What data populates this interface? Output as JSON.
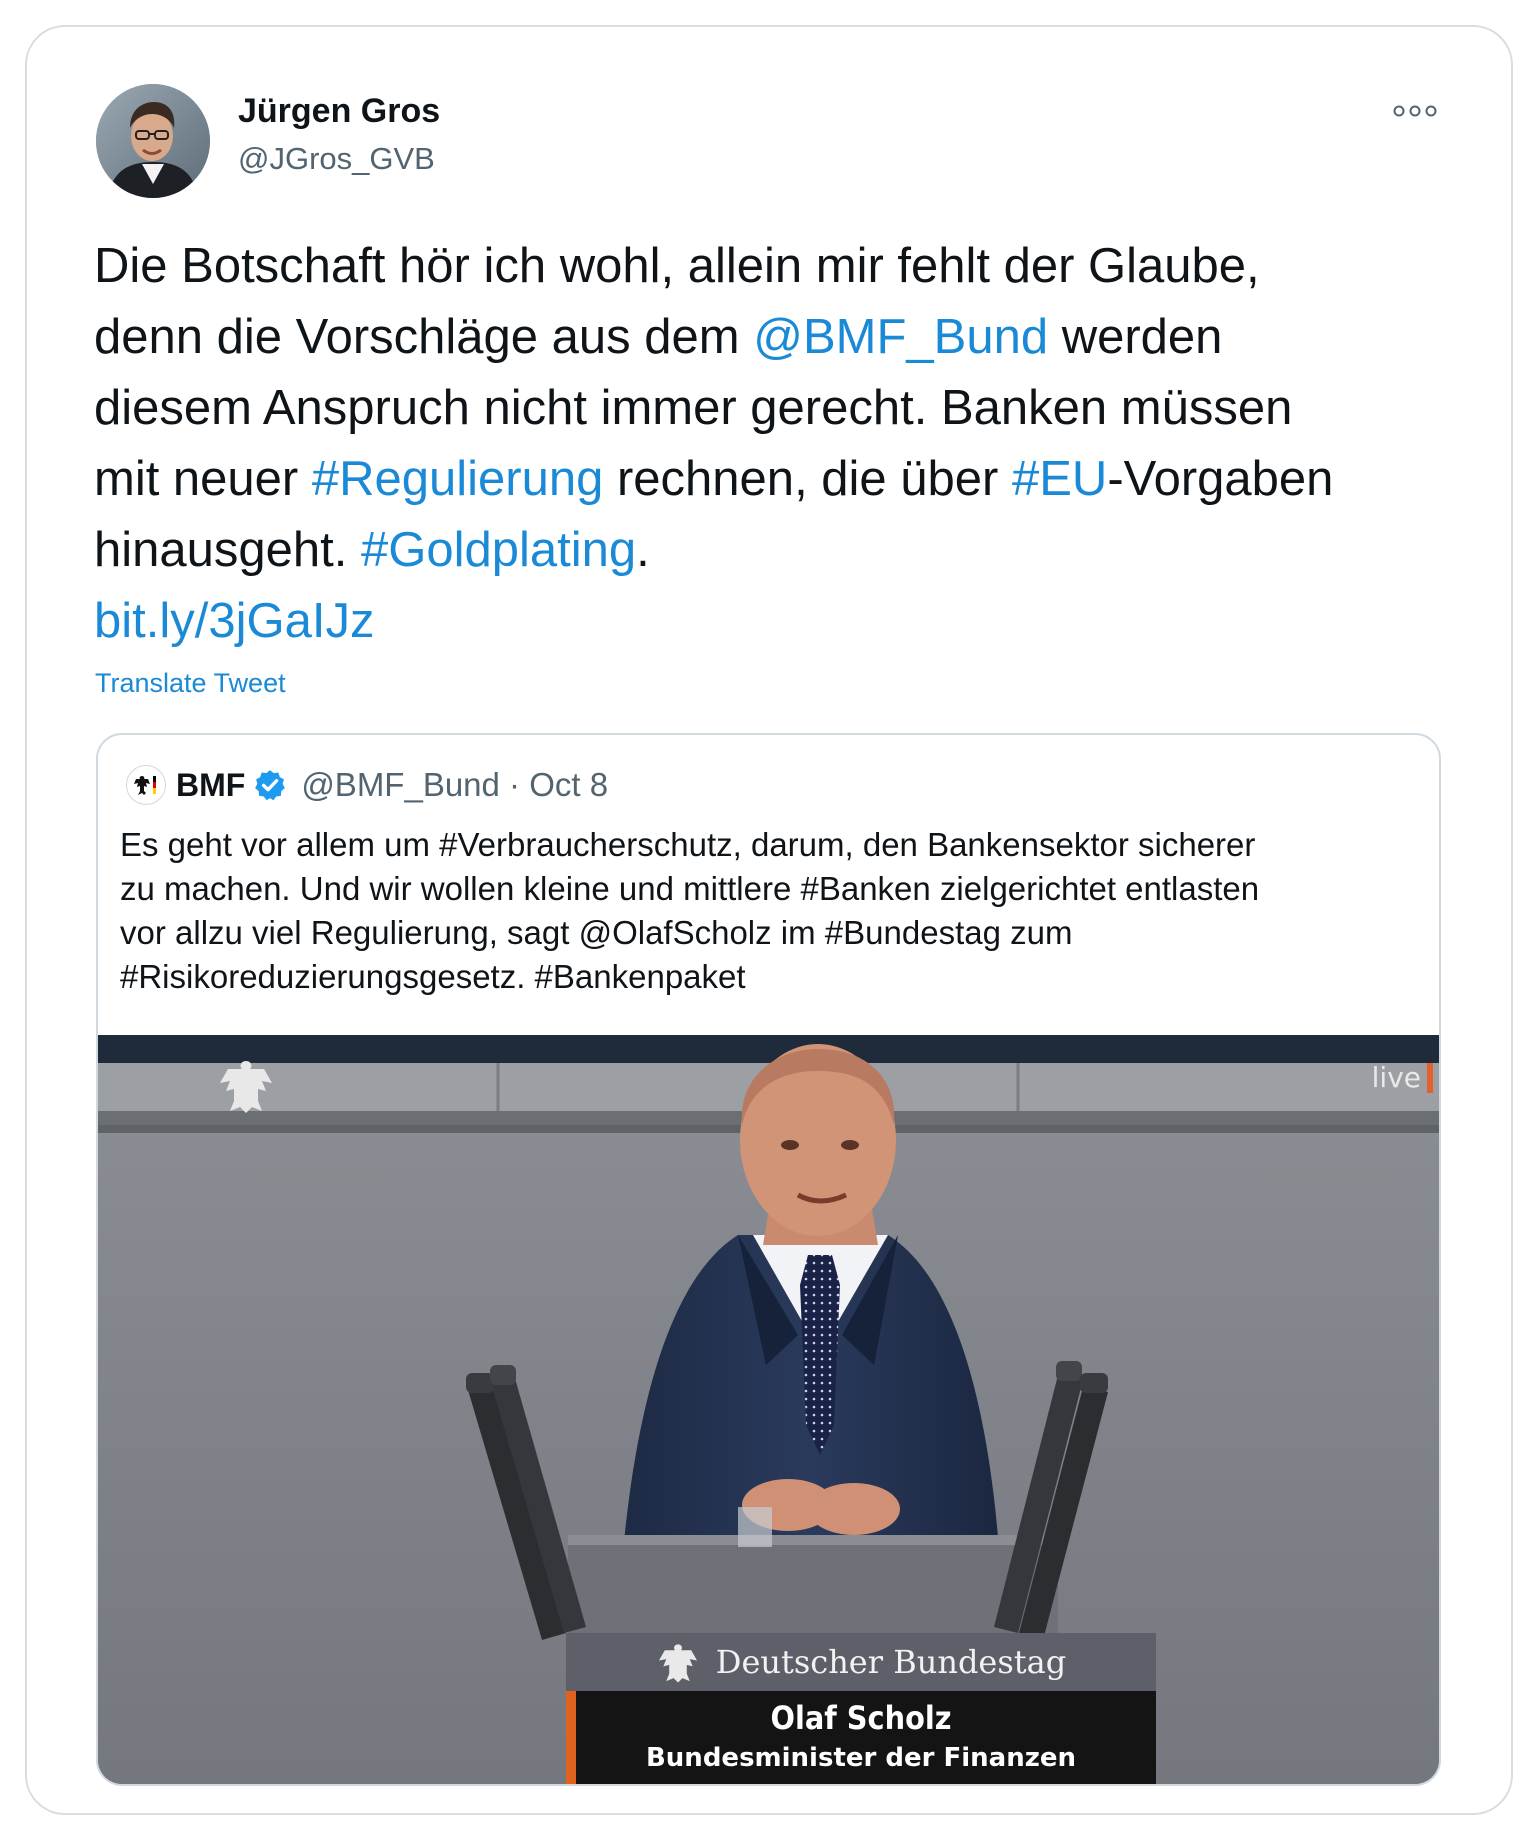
{
  "tweet": {
    "author": {
      "name": "Jürgen Gros",
      "handle": "@JGros_GVB",
      "avatar_icon": "profile-photo"
    },
    "more_icon": "more-options-icon",
    "text_lines": [
      [
        {
          "t": "Die Botschaft hör ich wohl, allein mir fehlt der Glaube,",
          "link": false
        }
      ],
      [
        {
          "t": "denn die Vorschläge aus dem ",
          "link": false
        },
        {
          "t": "@BMF_Bund",
          "link": true
        },
        {
          "t": " werden",
          "link": false
        }
      ],
      [
        {
          "t": "diesem Anspruch nicht immer gerecht. Banken müssen",
          "link": false
        }
      ],
      [
        {
          "t": "mit neuer ",
          "link": false
        },
        {
          "t": "#Regulierung",
          "link": true
        },
        {
          "t": " rechnen, die über ",
          "link": false
        },
        {
          "t": "#EU",
          "link": true
        },
        {
          "t": "-Vorgaben",
          "link": false
        }
      ],
      [
        {
          "t": "hinausgeht. ",
          "link": false
        },
        {
          "t": "#Goldplating",
          "link": true
        },
        {
          "t": ".",
          "link": false
        }
      ],
      [
        {
          "t": "bit.ly/3jGaIJz",
          "link": true
        }
      ]
    ],
    "translate_label": "Translate Tweet",
    "link_color": "#1b8ad6"
  },
  "quoted_tweet": {
    "author_name": "BMF",
    "verified_icon": "verified-badge-icon",
    "handle_date": "@BMF_Bund · Oct 8",
    "text_lines": [
      "Es geht vor allem um #Verbraucherschutz, darum, den Bankensektor sicherer",
      "zu machen. Und wir wollen kleine und mittlere #Banken zielgerichtet entlasten",
      "vor allzu viel Regulierung, sagt @OlafScholz im #Bundestag zum",
      "#Risikoreduzierungsgesetz. #Bankenpaket"
    ],
    "media": {
      "live_label": "live",
      "lower_third": {
        "institution": "Deutscher Bundestag",
        "speaker_name": "Olaf Scholz",
        "speaker_role": "Bundesminister der Finanzen"
      },
      "accent_color": "#e0621f"
    }
  }
}
